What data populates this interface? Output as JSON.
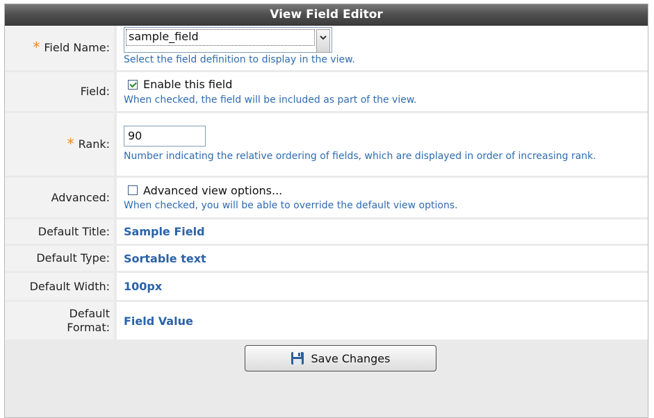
{
  "title": "View Field Editor",
  "required_marker": "*",
  "rows": {
    "field_name": {
      "label": "Field Name:",
      "value": "sample_field",
      "hint": "Select the field definition to display in the view."
    },
    "field": {
      "label": "Field:",
      "checkbox_label": "Enable this field",
      "checked": true,
      "hint": "When checked, the field will be included as part of the view."
    },
    "rank": {
      "label": "Rank:",
      "value": "90",
      "hint": "Number indicating the relative ordering of fields, which are displayed in order of increasing rank."
    },
    "advanced": {
      "label": "Advanced:",
      "checkbox_label": "Advanced view options...",
      "checked": false,
      "hint": "When checked, you will be able to override the default view options."
    },
    "default_title": {
      "label": "Default Title:",
      "value": "Sample Field"
    },
    "default_type": {
      "label": "Default Type:",
      "value": "Sortable text"
    },
    "default_width": {
      "label": "Default Width:",
      "value": "100px"
    },
    "default_format": {
      "label": "Default Format:",
      "value": "Field Value"
    }
  },
  "save_button": {
    "label": "Save Changes",
    "icon": "floppy-disk-icon"
  },
  "colors": {
    "accent_text": "#2a62a8",
    "hint_text": "#2f6bb0",
    "required": "#e8891a",
    "titlebar": "#4e4e4e"
  }
}
